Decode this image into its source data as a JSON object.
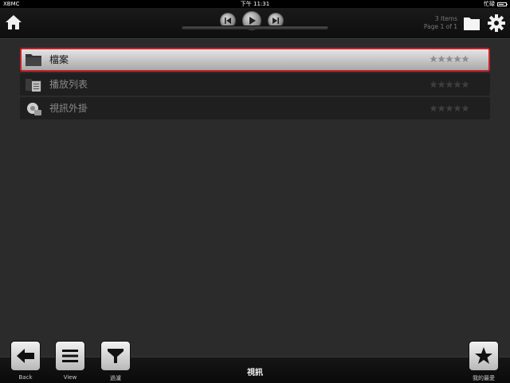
{
  "status_bar": {
    "carrier": "XBMC",
    "time": "下午 11:31",
    "activity": "忙碌",
    "battery_level": 0.7
  },
  "header": {
    "items_count": "3 Items",
    "page_info": "Page 1 of 1",
    "playback_progress": 0
  },
  "list": {
    "items": [
      {
        "label": "檔案",
        "icon": "folder-icon",
        "selected": true,
        "rating": 0
      },
      {
        "label": "播放列表",
        "icon": "playlist-folder-icon",
        "selected": false,
        "rating": 0
      },
      {
        "label": "視訊外掛",
        "icon": "video-addon-icon",
        "selected": false,
        "rating": 0
      }
    ]
  },
  "footer": {
    "back_label": "Back",
    "view_label": "View",
    "filter_label": "過濾",
    "section_title": "視訊",
    "favourites_label": "我的最愛"
  },
  "colors": {
    "selection_border": "#c92027",
    "background": "#2b2b2b"
  }
}
